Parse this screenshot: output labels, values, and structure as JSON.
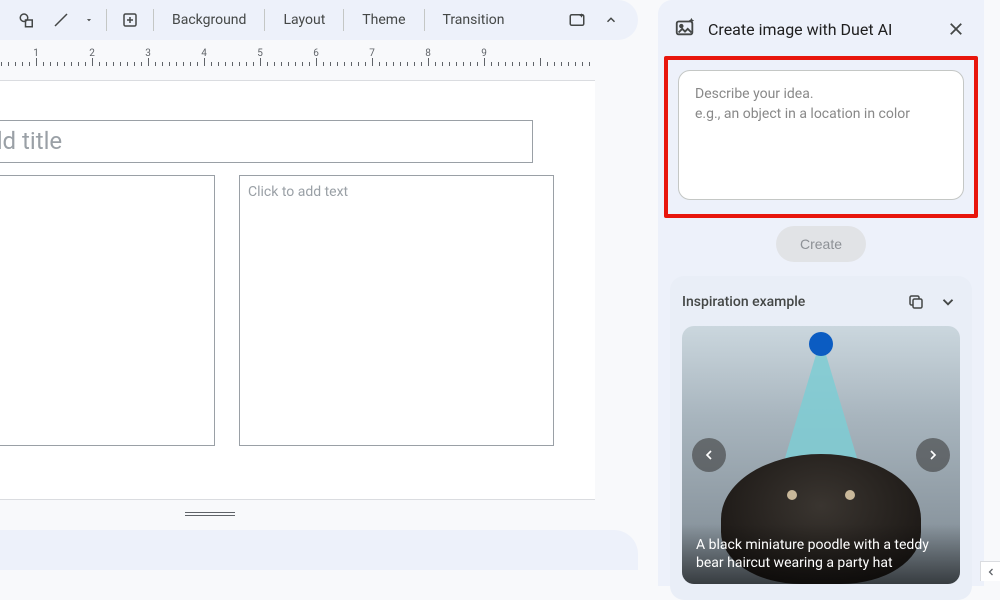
{
  "toolbar": {
    "background": "Background",
    "layout": "Layout",
    "theme": "Theme",
    "transition": "Transition"
  },
  "ruler": {
    "numbers": [
      1,
      2,
      3,
      4,
      5,
      6,
      7,
      8,
      9
    ]
  },
  "slide": {
    "title_placeholder": "dd title",
    "text_placeholder": "Click to add text"
  },
  "panel": {
    "title": "Create image with Duet AI",
    "prompt_placeholder": "Describe your idea.\ne.g., an object in a location in color",
    "create_label": "Create",
    "inspiration_title": "Inspiration example",
    "example_caption": "A black miniature poodle with a teddy bear haircut wearing a party hat"
  }
}
